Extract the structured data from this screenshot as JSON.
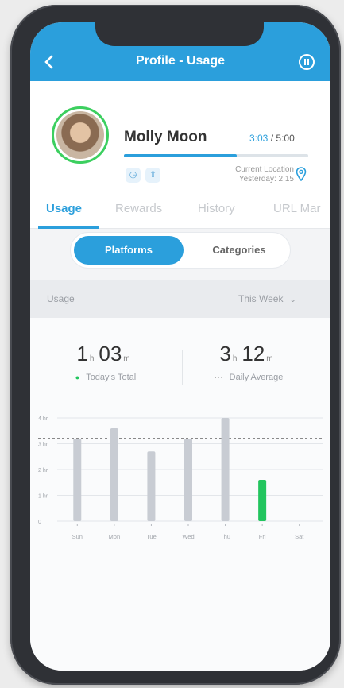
{
  "header": {
    "title": "Profile - Usage",
    "back_icon": "chevron-left-icon",
    "action_icon": "pause-icon"
  },
  "profile": {
    "name": "Molly Moon",
    "time_used": "3:03",
    "time_separator": "/",
    "time_limit": "5:00",
    "progress": 0.61,
    "location_line1": "Current Location",
    "location_line2": "Yesterday: 2:15"
  },
  "tabs": [
    {
      "label": "Usage"
    },
    {
      "label": "Rewards"
    },
    {
      "label": "History"
    },
    {
      "label": "URL Mar"
    }
  ],
  "segments": {
    "active": "Platforms",
    "inactive": "Categories"
  },
  "usage_bar": {
    "label": "Usage",
    "period": "This Week"
  },
  "stats": {
    "today": {
      "hours": "1",
      "hours_unit": "h",
      "minutes": "03",
      "minutes_unit": "m",
      "label": "Today's Total"
    },
    "average": {
      "hours": "3",
      "hours_unit": "h",
      "minutes": "12",
      "minutes_unit": "m",
      "label": "Daily Average"
    }
  },
  "colors": {
    "accent": "#2b9fdc",
    "today_bar": "#22c55e",
    "bar": "#c8ccd3",
    "avatar_ring": "#3ccf5f"
  },
  "chart_data": {
    "type": "bar",
    "categories": [
      "Sun",
      "Mon",
      "Tue",
      "Wed",
      "Thu",
      "Fri",
      "Sat"
    ],
    "values": [
      3.2,
      3.6,
      2.7,
      3.2,
      4.0,
      1.6,
      0
    ],
    "y_ticks": [
      "4 hr",
      "3 hr",
      "2 hr",
      "1 hr",
      "0"
    ],
    "ylim": [
      0,
      4
    ],
    "average_line": 3.2,
    "highlight_index": 5
  }
}
